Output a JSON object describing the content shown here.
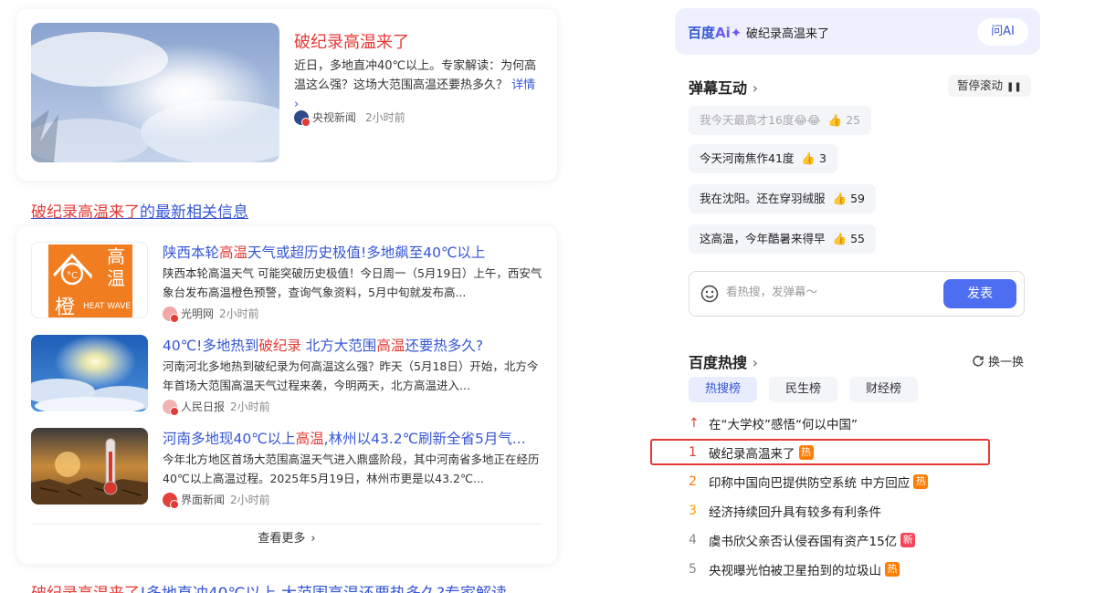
{
  "top_news": {
    "title": "破纪录高温来了",
    "description": "近日，多地直冲40℃以上。专家解读：为何高温这么强？这场大范围高温还要热多久？",
    "more": "详情",
    "source": "央视新闻",
    "time": "2小时前"
  },
  "latest": {
    "keyword": "破纪录高温来了",
    "suffix": "的最新相关信息"
  },
  "news": [
    {
      "title_pre": "陕西本轮",
      "title_hl": "高温",
      "title_post": "天气或超历史极值!多地飙至40℃以上",
      "desc": "陕西本轮高温天气 可能突破历史极值！今日周一（5月19日）上午，西安气象台发布高温橙色预警，查询气象资料，5月中旬就发布高...",
      "source": "光明网",
      "time": "2小时前",
      "thumb": {
        "line1": "高",
        "line2": "温",
        "level": "橙",
        "caption": "HEAT WAVE"
      }
    },
    {
      "title_pre": "40℃!多地热到",
      "title_hl": "破纪录",
      "title_mid": " 北方大范围",
      "title_hl2": "高温",
      "title_post": "还要热多久?",
      "desc": "河南河北多地热到破纪录为何高温这么强？昨天（5月18日）开始，北方今年首场大范围高温天气过程来袭，今明两天，北方高温进入...",
      "source": "人民日报",
      "time": "2小时前"
    },
    {
      "title_pre": "河南多地现40℃以上",
      "title_hl": "高温",
      "title_post": ",林州以43.2℃刷新全省5月气...",
      "desc": "今年北方地区首场大范围高温天气进入鼎盛阶段，其中河南省多地正在经历40℃以上高温过程。2025年5月19日，林州市更是以43.2℃...",
      "source": "界面新闻",
      "time": "2小时前"
    }
  ],
  "see_more": "查看更多",
  "bottom_link": {
    "red": "破纪录高温来了",
    "rest": "!多地直冲40℃以上 大范围高温还要热多久?专家解读"
  },
  "ai_bar": {
    "logo": "百度",
    "logo_ai": "Ai✦",
    "query": "破纪录高温来了",
    "ask_label": "问AI"
  },
  "danmu": {
    "title": "弹幕互动",
    "pause_label": "暂停滚动",
    "items": [
      {
        "text": "我今天最高才16度",
        "emoji": "😂😂",
        "likes": "25"
      },
      {
        "text": "今天河南焦作41度",
        "emoji": "",
        "likes": "3"
      },
      {
        "text": "我在沈阳。还在穿羽绒服",
        "emoji": "",
        "likes": "59"
      },
      {
        "text": "这高温，今年酷暑来得早",
        "emoji": "",
        "likes": "55"
      }
    ],
    "placeholder": "看热搜，发弹幕～",
    "send_label": "发表"
  },
  "hot": {
    "title": "百度热搜",
    "refresh_label": "换一换",
    "tabs": [
      "热搜榜",
      "民生榜",
      "财经榜"
    ],
    "items": [
      {
        "rank": "↑",
        "text": "在“大学校”感悟“何以中国”",
        "badge": "",
        "rank_color": "#e53935"
      },
      {
        "rank": "1",
        "text": "破纪录高温来了",
        "badge": "热",
        "rank_color": "#e53935"
      },
      {
        "rank": "2",
        "text": "印称中国向巴提供防空系统 中方回应",
        "badge": "热",
        "rank_color": "#f57c00"
      },
      {
        "rank": "3",
        "text": "经济持续回升具有较多有利条件",
        "badge": "",
        "rank_color": "#f4a300"
      },
      {
        "rank": "4",
        "text": "虞书欣父亲否认侵吞国有资产15亿",
        "badge": "新",
        "rank_color": "#888888"
      },
      {
        "rank": "5",
        "text": "央视曝光怕被卫星拍到的垃圾山",
        "badge": "热",
        "rank_color": "#888888"
      }
    ],
    "badge_colors": {
      "热": "#ff7d00",
      "新": "#f5455c"
    }
  }
}
